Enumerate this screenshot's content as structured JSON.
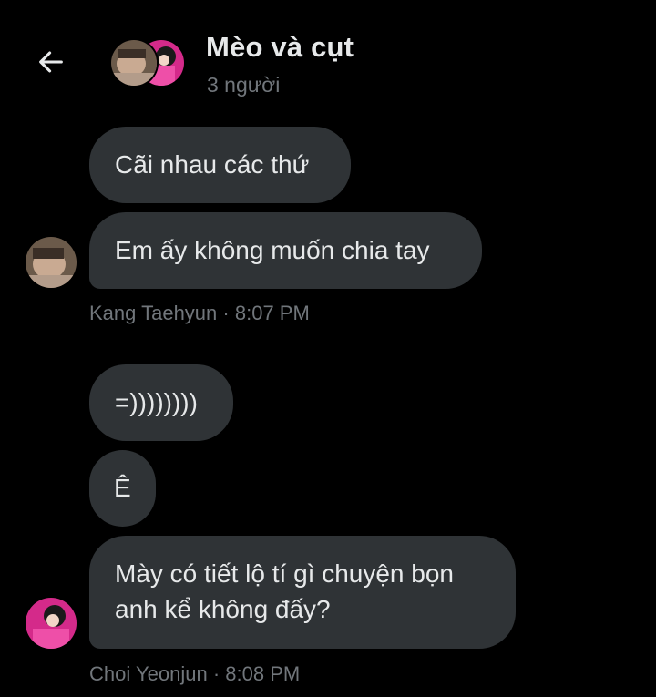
{
  "header": {
    "title": "Mèo và cụt",
    "subtitle": "3 người"
  },
  "groups": [
    {
      "sender": "Kang Taehyun",
      "time": "8:07 PM",
      "meta_separator": "·",
      "messages": [
        "Cãi nhau các thứ",
        "Em ấy không muốn chia tay"
      ]
    },
    {
      "sender": "Choi Yeonjun",
      "time": "8:08 PM",
      "meta_separator": "·",
      "messages": [
        "=))))))))",
        "Ê",
        "Mày có tiết lộ tí gì chuyện bọn anh kể không đấy?"
      ]
    }
  ],
  "colors": {
    "background": "#000000",
    "bubble": "#2f3336",
    "text": "#e7e9ea",
    "muted": "#71767b"
  },
  "icons": {
    "back": "arrow-left-icon"
  }
}
